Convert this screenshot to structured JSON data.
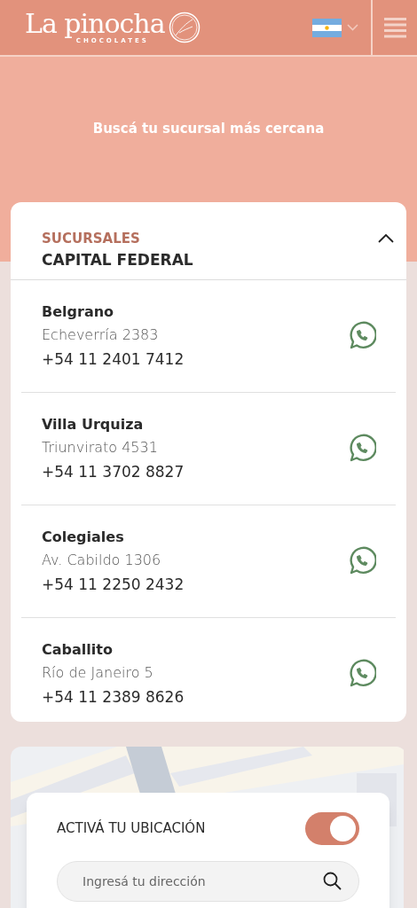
{
  "header": {
    "logo": {
      "name": "La pinocha",
      "tagline": "CHOCOLATES"
    }
  },
  "hero": {
    "title": "Buscá tu sucursal más cercana"
  },
  "branches": {
    "label": "SUCURSALES",
    "region": "CAPITAL FEDERAL",
    "expanded": true,
    "items": [
      {
        "name": "Belgrano",
        "address": "Echeverría 2383",
        "phone": "+54 11 2401 7412"
      },
      {
        "name": "Villa Urquiza",
        "address": "Triunvirato 4531",
        "phone": "+54 11 3702 8827"
      },
      {
        "name": "Colegiales",
        "address": "Av. Cabildo 1306",
        "phone": "+54 11 2250 2432"
      },
      {
        "name": "Caballito",
        "address": "Río de Janeiro 5",
        "phone": "+54 11 2389 8626"
      }
    ]
  },
  "map": {
    "kind": "picture",
    "location": {
      "label": "ACTIVÁ TU UBICACIÓN",
      "on": true
    },
    "search": {
      "placeholder": "Ingresá tu dirección"
    }
  }
}
